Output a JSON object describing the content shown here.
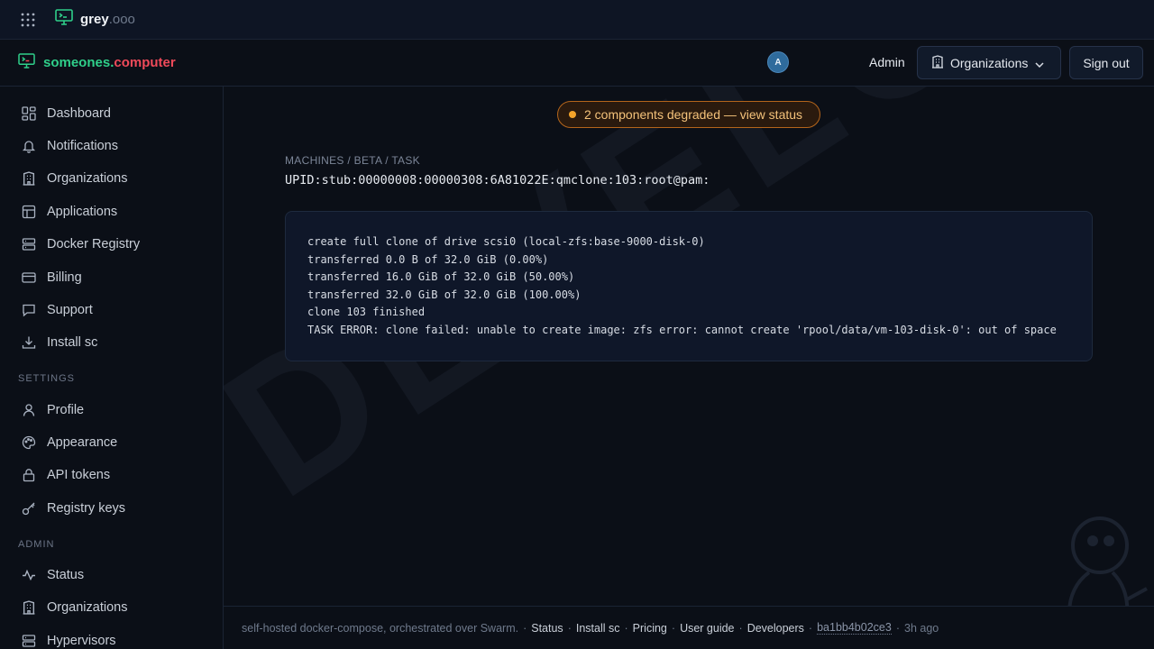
{
  "topbar": {
    "brand_name": "grey",
    "brand_suffix": ".ooo"
  },
  "header": {
    "brand_part1": "someones",
    "brand_dot": ".",
    "brand_part2": "computer",
    "avatar_initial": "A",
    "admin_label": "Admin",
    "organizations_button": "Organizations",
    "signout_button": "Sign out"
  },
  "sidebar": {
    "main_items": [
      {
        "label": "Dashboard",
        "icon": "dashboard-icon"
      },
      {
        "label": "Notifications",
        "icon": "bell-icon"
      },
      {
        "label": "Organizations",
        "icon": "building-icon"
      },
      {
        "label": "Applications",
        "icon": "layout-icon"
      },
      {
        "label": "Docker Registry",
        "icon": "server-icon"
      },
      {
        "label": "Billing",
        "icon": "credit-card-icon"
      },
      {
        "label": "Support",
        "icon": "message-icon"
      },
      {
        "label": "Install sc",
        "icon": "download-icon"
      }
    ],
    "settings_label": "SETTINGS",
    "settings_items": [
      {
        "label": "Profile",
        "icon": "user-icon"
      },
      {
        "label": "Appearance",
        "icon": "palette-icon"
      },
      {
        "label": "API tokens",
        "icon": "lock-icon"
      },
      {
        "label": "Registry keys",
        "icon": "key-icon"
      }
    ],
    "admin_label": "ADMIN",
    "admin_items": [
      {
        "label": "Status",
        "icon": "activity-icon"
      },
      {
        "label": "Organizations",
        "icon": "building-icon"
      },
      {
        "label": "Hypervisors",
        "icon": "server-icon"
      }
    ]
  },
  "main": {
    "status_banner": "2 components degraded — view status",
    "breadcrumb": "MACHINES / BETA / TASK",
    "task_id": "UPID:stub:00000008:00000308:6A81022E:qmclone:103:root@pam:",
    "log_lines": [
      "create full clone of drive scsi0 (local-zfs:base-9000-disk-0)",
      "transferred 0.0 B of 32.0 GiB (0.00%)",
      "transferred 16.0 GiB of 32.0 GiB (50.00%)",
      "transferred 32.0 GiB of 32.0 GiB (100.00%)",
      "clone 103 finished",
      "TASK ERROR: clone failed: unable to create image: zfs error: cannot create 'rpool/data/vm-103-disk-0': out of space"
    ],
    "watermark": "DEVELOPMENT"
  },
  "footer": {
    "text": "self-hosted docker-compose, orchestrated over Swarm.",
    "links": [
      "Status",
      "Install sc",
      "Pricing",
      "User guide",
      "Developers"
    ],
    "commit": "ba1bb4b02ce3",
    "age": "3h ago"
  },
  "colors": {
    "accent_green": "#2fcf8a",
    "accent_red": "#ef4a5a",
    "warning": "#f4a42a"
  }
}
